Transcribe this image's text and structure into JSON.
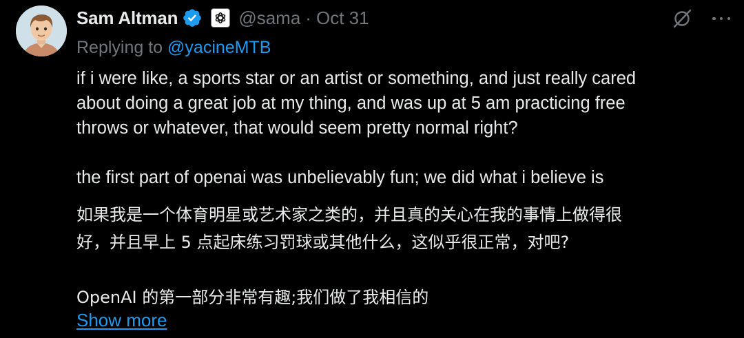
{
  "tweet": {
    "author": {
      "name": "Sam Altman",
      "handle": "@sama",
      "separator": "·",
      "date": "Oct 31",
      "avatar_icon": "profile-avatar",
      "verified_icon": "verified-badge-icon",
      "affiliation_icon": "openai-logo-icon"
    },
    "replying": {
      "prefix": "Replying to ",
      "mention": "@yacineMTB"
    },
    "text": {
      "paragraph1": "if i were like, a sports star or an artist or something, and just really cared\nabout doing a great job at my thing, and was up at 5 am practicing free\nthrows or whatever, that would seem pretty normal right?",
      "paragraph2": "the first part of openai was unbelievably fun; we did what i believe is",
      "translation1": "如果我是一个体育明星或艺术家之类的，并且真的关心在我的事情上做得很\n好，并且早上 5 点起床练习罚球或其他什么，这似乎很正常，对吧?",
      "translation2": "OpenAI 的第一部分非常有趣;我们做了我相信的"
    },
    "show_more": "Show more",
    "actions": {
      "grok_icon": "grok-icon",
      "more_icon": "more-options-icon"
    }
  },
  "colors": {
    "background": "#000000",
    "primary_text": "#e7e9ea",
    "secondary_text": "#71767b",
    "link": "#1d9bf0"
  }
}
